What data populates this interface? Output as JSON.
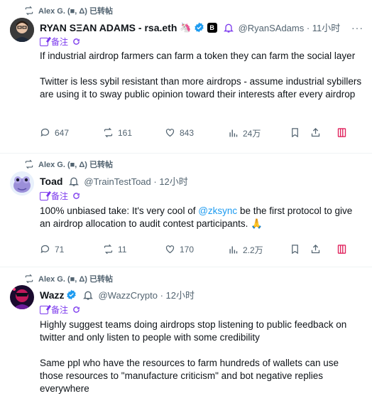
{
  "colors": {
    "text": "#0f1419",
    "muted": "#536471",
    "link": "#1d9bf0",
    "note": "#7c3aed",
    "ext": "#e0245e"
  },
  "tweets": [
    {
      "retweeted_by": "Alex G. (■, Δ) 已转帖",
      "name": "RYAN SΞAN ADAMS - rsa.eth",
      "emoji": "🦄",
      "badge": "B",
      "handle": "@RyanSAdams · 11小时",
      "note": "备注",
      "paragraphs": [
        "If industrial airdrop farmers can farm a token they can farm the social layer",
        "Twitter is less sybil resistant than more airdrops - assume industrial sybillers are using it to sway public opinion toward their interests after every airdrop"
      ],
      "replies": "647",
      "retweets": "161",
      "likes": "843",
      "views": "24万"
    },
    {
      "retweeted_by": "Alex G. (■, Δ) 已转帖",
      "name": "Toad",
      "handle": "@TrainTestToad · 12小时",
      "note": "备注",
      "text_before": "100% unbiased take: It's very cool of ",
      "mention": "@zksync",
      "text_after": " be the first protocol to give an airdrop allocation to audit contest participants. 🙏",
      "replies": "71",
      "retweets": "11",
      "likes": "170",
      "views": "2.2万"
    },
    {
      "retweeted_by": "Alex G. (■, Δ) 已转帖",
      "name": "Wazz",
      "handle": "@WazzCrypto · 12小时",
      "note": "备注",
      "paragraphs": [
        "Highly suggest teams doing airdrops stop listening to public feedback on twitter and only listen to people with some credibility",
        "Same ppl who have the resources to farm hundreds of wallets can use those resources to \"manufacture criticism\" and bot negative replies everywhere"
      ]
    }
  ]
}
